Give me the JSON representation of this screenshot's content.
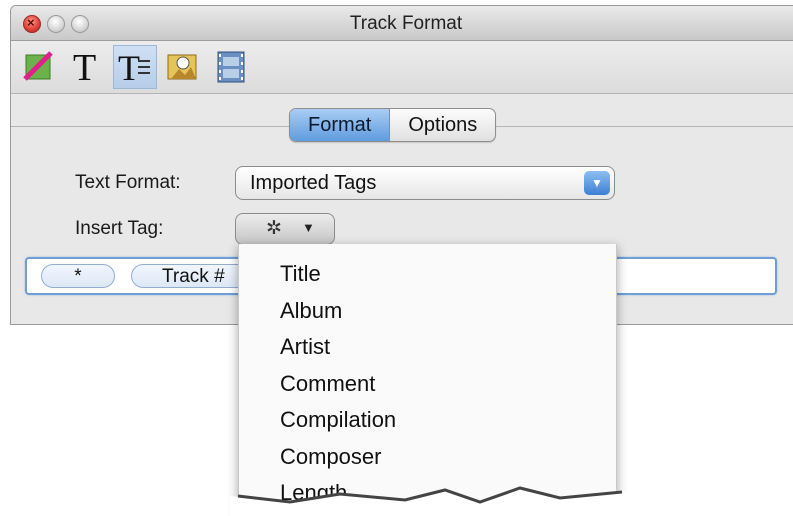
{
  "window": {
    "title": "Track Format"
  },
  "toolbar": {
    "tools": [
      "clear-format-icon",
      "text-icon",
      "text-format-icon",
      "image-icon",
      "filmstrip-icon"
    ],
    "selected": "text-format-icon"
  },
  "tabs": [
    "Format",
    "Options"
  ],
  "selected_tab": "Format",
  "form": {
    "text_format_label": "Text Format:",
    "text_format_value": "Imported Tags",
    "insert_tag_label": "Insert Tag:"
  },
  "tokens": [
    "*",
    "Track #"
  ],
  "menu": {
    "items": [
      "Title",
      "Album",
      "Artist",
      "Comment",
      "Compilation",
      "Composer",
      "Length"
    ]
  },
  "colors": {
    "selection_blue": "#5f9ce0",
    "focus_ring": "#6f9fd6"
  }
}
